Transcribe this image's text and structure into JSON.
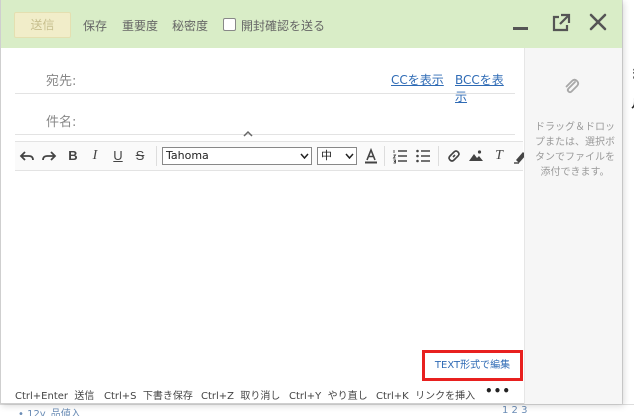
{
  "header": {
    "send_label": "送信",
    "save_label": "保存",
    "importance_label": "重要度",
    "confidentiality_label": "秘密度",
    "read_receipt_label": "開封確認を送る",
    "background_color": "#d9edc7"
  },
  "fields": {
    "to_label": "宛先:",
    "cc_link": "CCを表示",
    "bcc_link": "BCCを表示",
    "subject_label": "件名:"
  },
  "toolbar": {
    "bold": "B",
    "italic": "I",
    "underline": "U",
    "strike": "S",
    "font_family": "Tahoma",
    "font_size": "中",
    "clear_format": "T"
  },
  "attach": {
    "hint": "ドラッグ＆ドロップまたは、選択ボタンでファイルを添付できます。"
  },
  "text_mode_link": "TEXT形式で編集",
  "shortcuts": [
    {
      "key": "Ctrl+Enter",
      "action": "送信"
    },
    {
      "key": "Ctrl+S",
      "action": "下書き保存"
    },
    {
      "key": "Ctrl+Z",
      "action": "取り消し"
    },
    {
      "key": "Ctrl+Y",
      "action": "やり直し"
    },
    {
      "key": "Ctrl+K",
      "action": "リンクを挿入"
    }
  ],
  "more_label": "•••",
  "background": {
    "right_glyph_1": "ま",
    "right_glyph_2": "ル",
    "bottom_text": "• 12y_品値入",
    "bottom_pager": "1 2 3"
  },
  "colors": {
    "link": "#2f6bb5",
    "highlight_border": "#e8201f"
  }
}
